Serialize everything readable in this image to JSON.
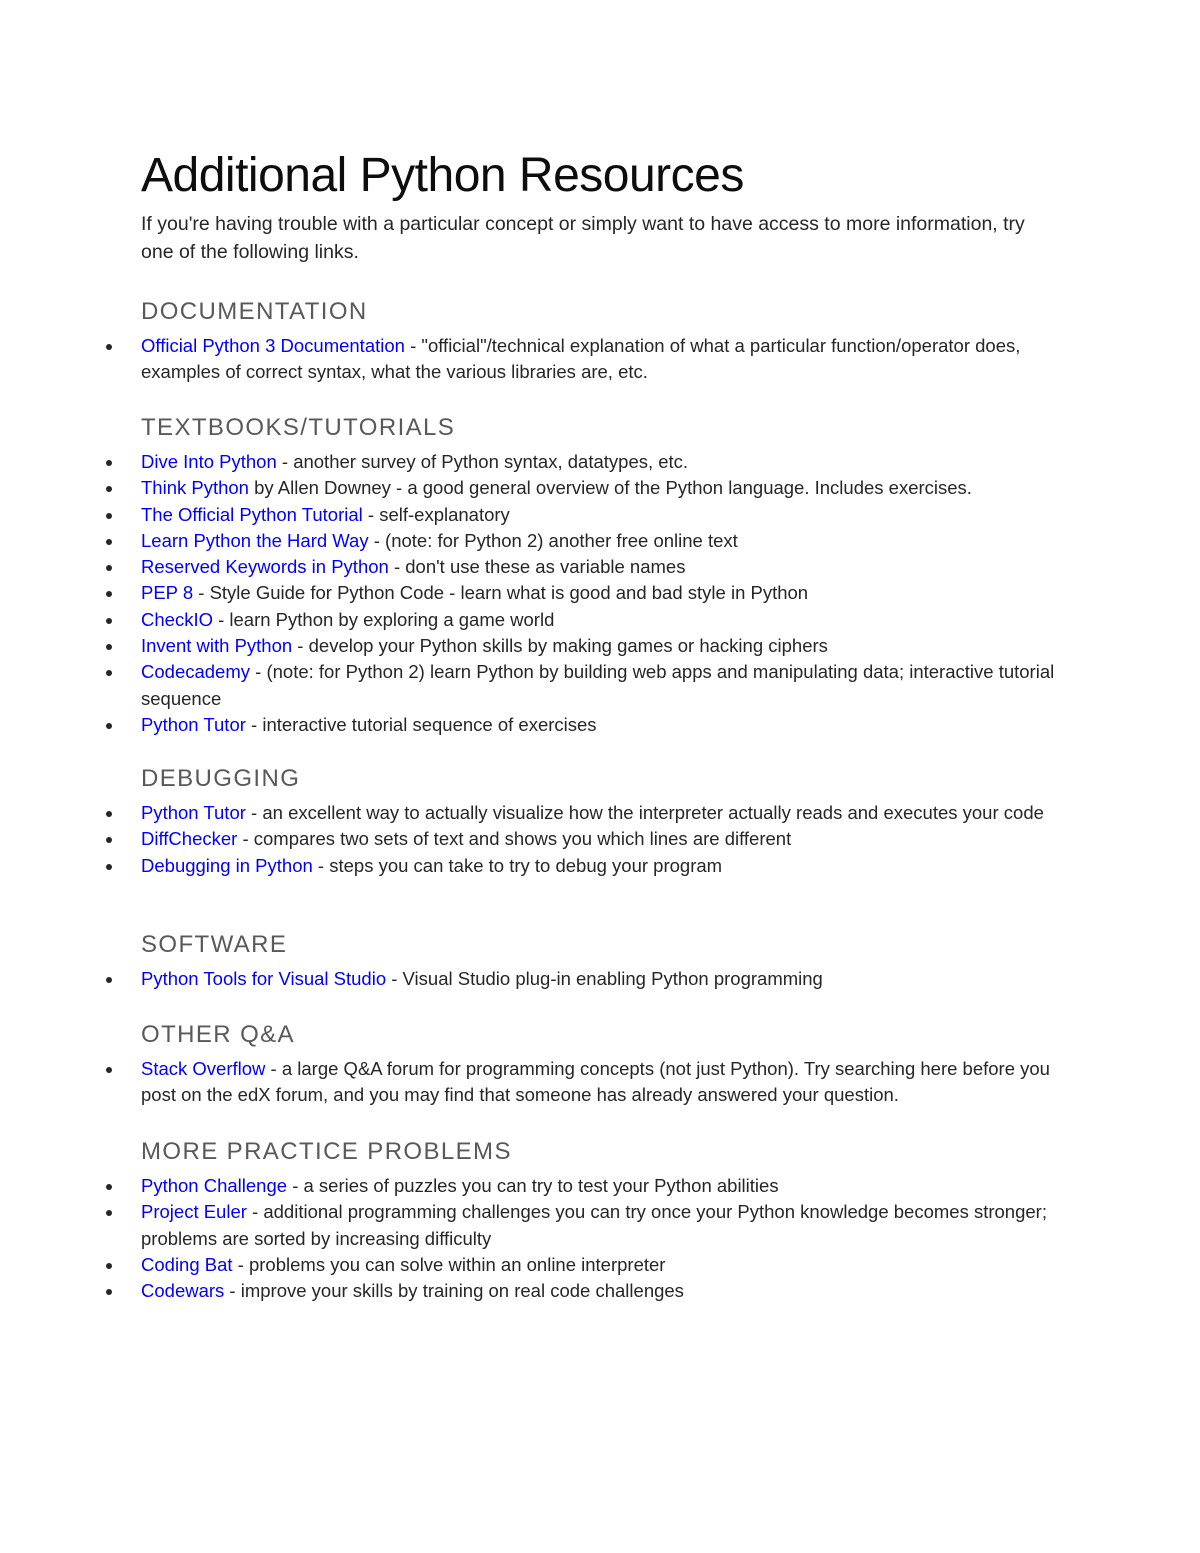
{
  "document": {
    "title": "Additional Python Resources",
    "intro": "If you're having trouble with a particular concept or simply want to have access to more information, try one of the following links.",
    "colors": {
      "link": "#0000ff",
      "heading": "#595959",
      "body": "#262626"
    },
    "sections": [
      {
        "heading": "DOCUMENTATION",
        "items": [
          {
            "link": "Official Python 3 Documentation",
            "text": " - \"official\"/technical explanation of what a particular function/operator does, examples of correct syntax, what the various libraries are, etc."
          }
        ]
      },
      {
        "heading": "TEXTBOOKS/TUTORIALS",
        "items": [
          {
            "link": "Dive Into Python",
            "text": " - another survey of Python syntax, datatypes, etc."
          },
          {
            "link": "Think Python",
            "text": " by Allen Downey - a good general overview of the Python language. Includes exercises."
          },
          {
            "link": "The Official Python Tutorial",
            "text": " - self-explanatory"
          },
          {
            "link": "Learn Python the Hard Way",
            "text": " - (note: for Python 2) another free online text"
          },
          {
            "link": "Reserved Keywords in Python",
            "text": " - don't use these as variable names"
          },
          {
            "link": "PEP 8",
            "text": " - Style Guide for Python Code - learn what is good and bad style in Python"
          },
          {
            "link": "CheckIO",
            "text": " - learn Python by exploring a game world"
          },
          {
            "link": "Invent with Python",
            "text": " - develop your Python skills by making games or hacking ciphers"
          },
          {
            "link": "Codecademy",
            "text": " - (note: for Python 2) learn Python by building web apps and manipulating data; interactive tutorial sequence"
          },
          {
            "link": "Python Tutor",
            "text": " - interactive tutorial sequence of exercises"
          }
        ]
      },
      {
        "heading": "DEBUGGING",
        "items": [
          {
            "link": "Python Tutor",
            "text": " - an excellent way to actually visualize how the interpreter actually reads and executes your code"
          },
          {
            "link": "DiffChecker",
            "text": " - compares two sets of text and shows you which lines are different"
          },
          {
            "link": "Debugging in Python",
            "text": " - steps you can take to try to debug your program"
          }
        ]
      },
      {
        "heading": "SOFTWARE",
        "items": [
          {
            "link": "Python Tools for Visual Studio",
            "text": " - Visual Studio plug-in enabling Python programming"
          }
        ]
      },
      {
        "heading": "OTHER Q&A",
        "items": [
          {
            "link": "Stack Overflow",
            "text": " - a large Q&A forum for programming concepts (not just Python). Try searching here before you post on the edX forum, and you may find that someone has already answered your question."
          }
        ]
      },
      {
        "heading": "MORE PRACTICE PROBLEMS",
        "items": [
          {
            "link": "Python Challenge",
            "text": " - a series of puzzles you can try to test your Python abilities"
          },
          {
            "link": "Project Euler",
            "text": " - additional programming challenges you can try once your Python knowledge becomes stronger; problems are sorted by increasing difficulty"
          },
          {
            "link": "Coding Bat",
            "text": " - problems you can solve within an online interpreter"
          },
          {
            "link": "Codewars",
            "text": " - improve your skills by training on real code challenges"
          }
        ]
      }
    ]
  }
}
